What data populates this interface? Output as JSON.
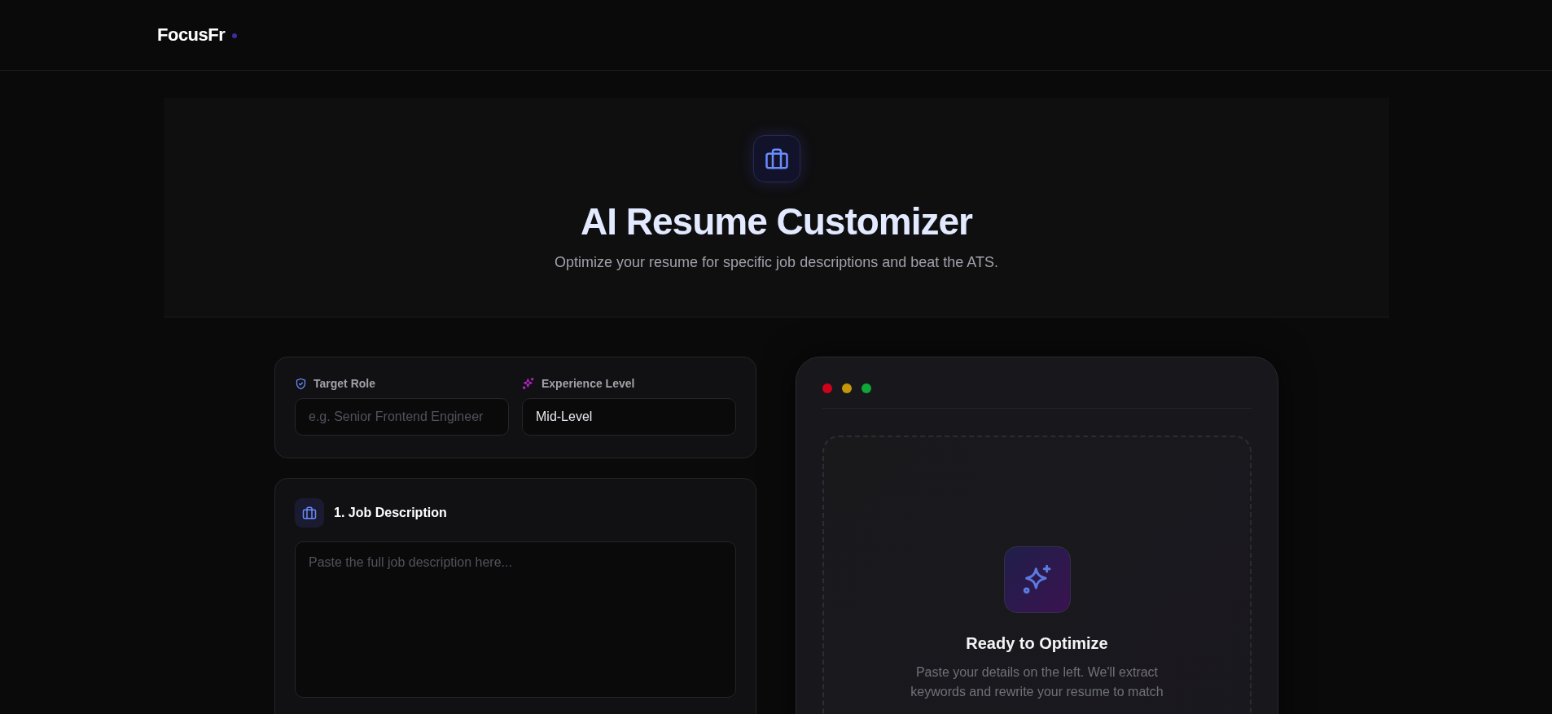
{
  "header": {
    "logo": "FocusFr"
  },
  "hero": {
    "title": "AI Resume Customizer",
    "subtitle": "Optimize your resume for specific job descriptions and beat the ATS."
  },
  "settings": {
    "fields": [
      {
        "kind": "text",
        "label": "Target Role",
        "placeholder": "e.g. Senior Frontend Engineer"
      },
      {
        "kind": "select",
        "label": "Experience Level",
        "value": "Mid-Level"
      }
    ]
  },
  "job_description": {
    "title": "1. Job Description",
    "placeholder": "Paste the full job description here..."
  },
  "preview": {
    "title": "Ready to Optimize",
    "description": "Paste your details on the left. We'll extract keywords and rewrite your resume to match"
  }
}
